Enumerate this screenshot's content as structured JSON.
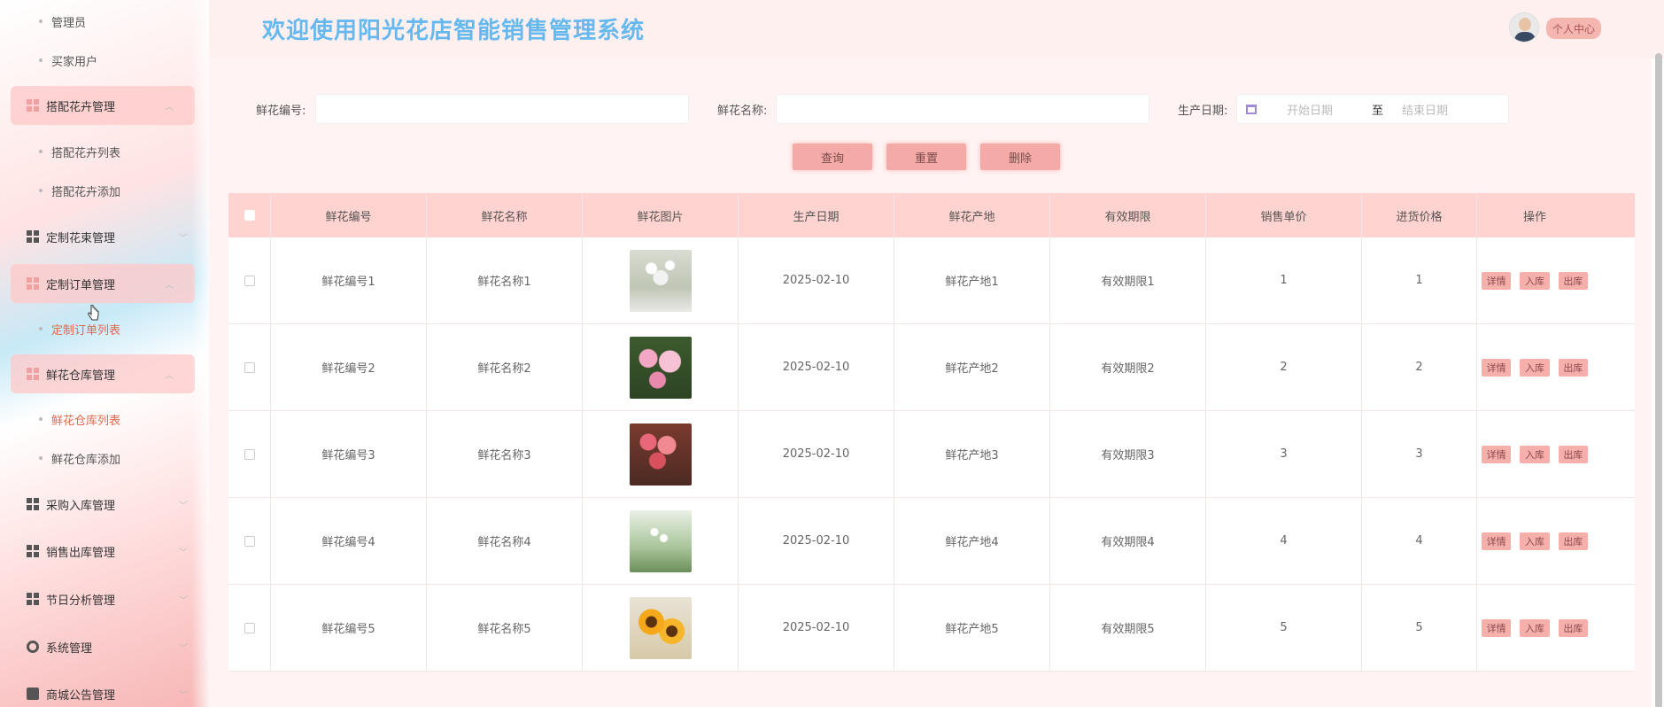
{
  "app_title": "欢迎使用阳光花店智能销售管理系统",
  "header": {
    "profile_label": "个人中心"
  },
  "sidebar": {
    "items": [
      {
        "label": "管理员",
        "kind": "sub"
      },
      {
        "label": "买家用户",
        "kind": "sub"
      },
      {
        "label": "搭配花卉管理",
        "kind": "group",
        "open": true
      },
      {
        "label": "搭配花卉列表",
        "kind": "sub"
      },
      {
        "label": "搭配花卉添加",
        "kind": "sub"
      },
      {
        "label": "定制花束管理",
        "kind": "group"
      },
      {
        "label": "定制订单管理",
        "kind": "group",
        "open": true
      },
      {
        "label": "定制订单列表",
        "kind": "sub",
        "active": true
      },
      {
        "label": "鲜花仓库管理",
        "kind": "group",
        "open": true
      },
      {
        "label": "鲜花仓库列表",
        "kind": "sub",
        "active": true
      },
      {
        "label": "鲜花仓库添加",
        "kind": "sub"
      },
      {
        "label": "采购入库管理",
        "kind": "group"
      },
      {
        "label": "销售出库管理",
        "kind": "group"
      },
      {
        "label": "节日分析管理",
        "kind": "group"
      },
      {
        "label": "系统管理",
        "kind": "group",
        "icon": "gear-icon"
      },
      {
        "label": "商城公告管理",
        "kind": "group",
        "icon": "document-icon"
      }
    ]
  },
  "search": {
    "code_label": "鲜花编号:",
    "name_label": "鲜花名称:",
    "date_label": "生产日期:",
    "date_start_placeholder": "开始日期",
    "date_to": "至",
    "date_end_placeholder": "结束日期",
    "query_button": "查询",
    "reset_button": "重置",
    "delete_button": "删除"
  },
  "table": {
    "columns": [
      "鲜花编号",
      "鲜花名称",
      "鲜花图片",
      "生产日期",
      "鲜花产地",
      "有效期限",
      "销售单价",
      "进货价格",
      "操作"
    ],
    "row_actions": [
      "详情",
      "入库",
      "出库"
    ],
    "rows": [
      {
        "code": "鲜花编号1",
        "name": "鲜花名称1",
        "image": "white-branch-flowers",
        "date": "2025-02-10",
        "origin": "鲜花产地1",
        "validity": "有效期限1",
        "price": "1",
        "cost": "1"
      },
      {
        "code": "鲜花编号2",
        "name": "鲜花名称2",
        "image": "pink-lilies",
        "date": "2025-02-10",
        "origin": "鲜花产地2",
        "validity": "有效期限2",
        "price": "2",
        "cost": "2"
      },
      {
        "code": "鲜花编号3",
        "name": "鲜花名称3",
        "image": "red-blossoms",
        "date": "2025-02-10",
        "origin": "鲜花产地3",
        "validity": "有效期限3",
        "price": "3",
        "cost": "3"
      },
      {
        "code": "鲜花编号4",
        "name": "鲜花名称4",
        "image": "lily-of-the-valley",
        "date": "2025-02-10",
        "origin": "鲜花产地4",
        "validity": "有效期限4",
        "price": "4",
        "cost": "4"
      },
      {
        "code": "鲜花编号5",
        "name": "鲜花名称5",
        "image": "sunflowers",
        "date": "2025-02-10",
        "origin": "鲜花产地5",
        "validity": "有效期限5",
        "price": "5",
        "cost": "5"
      }
    ]
  },
  "colors": {
    "title": "#66b9ee",
    "accent": "#f4aaa6",
    "table_header": "#ffd3cf",
    "active_menu": "#e06a4e"
  }
}
